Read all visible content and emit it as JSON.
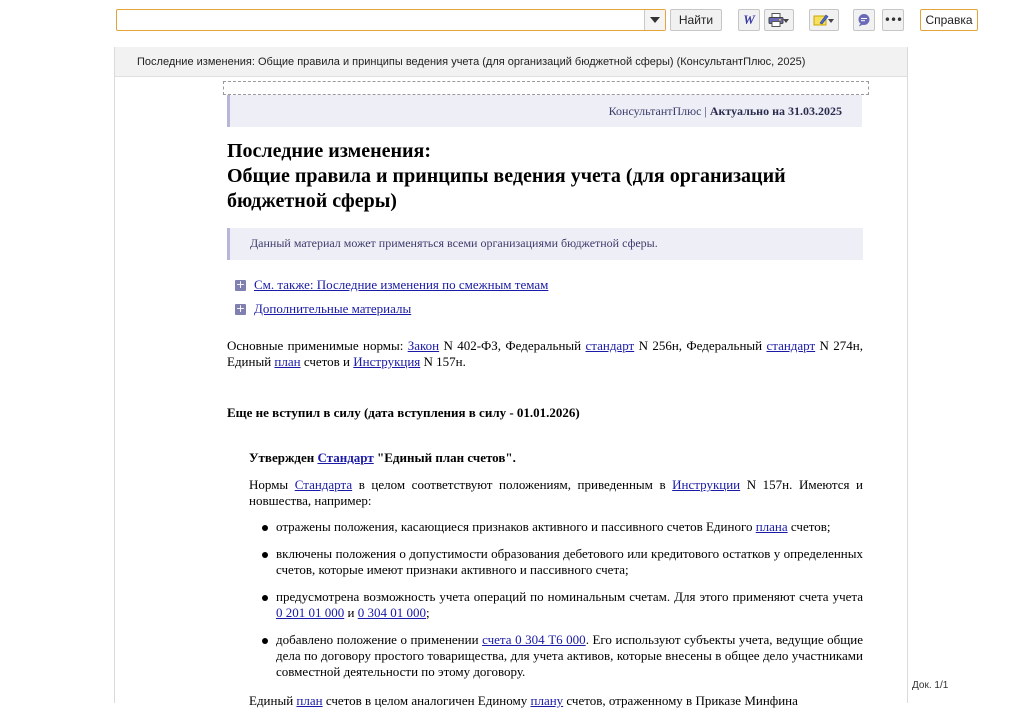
{
  "toolbar": {
    "search": {
      "value": "",
      "placeholder": ""
    },
    "find_label": "Найти",
    "word_icon_label": "W",
    "help_label": "Справка"
  },
  "document": {
    "header": "Последние изменения: Общие правила и принципы ведения учета (для организаций бюджетной сферы) (КонсультантПлюс, 2025)",
    "actual": {
      "source": "КонсультантПлюс |",
      "date_label": "Актуально на 31.03.2025"
    },
    "title_lines": [
      "Последние изменения:",
      "Общие правила и принципы ведения учета (для организаций",
      "бюджетной сферы)"
    ],
    "note": "Данный материал может применяться всеми организациями бюджетной сферы.",
    "expanders": [
      {
        "label": "См. также: Последние изменения по смежным темам"
      },
      {
        "label": "Дополнительные материалы"
      }
    ],
    "norms": {
      "t1": "Основные применимые нормы: ",
      "l1": "Закон",
      "t2": " N 402-ФЗ, Федеральный ",
      "l2": "стандарт",
      "t3": " N 256н, Федеральный ",
      "l3": "стандарт",
      "t4": " N 274н, Единый ",
      "l4": "план",
      "t5": " счетов и ",
      "l5": "Инструкция",
      "t6": " N 157н."
    },
    "not_in_force": "Еще не вступил в силу (дата вступления в силу - 01.01.2026)",
    "approved": {
      "t1": "Утвержден ",
      "l1": "Стандарт",
      "t2": " \"Единый план счетов\"."
    },
    "norms2": {
      "t1": "Нормы ",
      "l1": "Стандарта",
      "t2": " в целом соответствуют положениям, приведенным в ",
      "l2": "Инструкции",
      "t3": " N 157н. Имеются и новшества, например:"
    },
    "bullets": [
      {
        "t1": "отражены положения, касающиеся признаков активного и пассивного счетов Единого ",
        "l1": "плана",
        "t2": " счетов;"
      },
      {
        "t1": "включены положения о допустимости образования дебетового или кредитового остатков у определенных счетов, которые имеют признаки активного и пассивного счета;"
      },
      {
        "t1": "предусмотрена возможность учета операций по номинальным счетам. Для этого применяют счета учета ",
        "l1": "0 201 01 000",
        "t2": " и ",
        "l2": "0 304 01 000",
        "t3": ";"
      },
      {
        "t1": "добавлено положение о применении ",
        "l1": "счета 0 304 Т6 000",
        "t2": ". Его используют субъекты учета, ведущие общие дела по договору простого товарищества, для учета активов, которые внесены в общее дело участниками совместной деятельности по этому договору."
      }
    ],
    "last": {
      "t1": "Единый ",
      "l1": "план",
      "t2": " счетов в целом аналогичен Единому ",
      "l2": "плану",
      "t3": " счетов, отраженному в Приказе Минфина"
    }
  },
  "pager": {
    "label": "Док. 1/1"
  }
}
